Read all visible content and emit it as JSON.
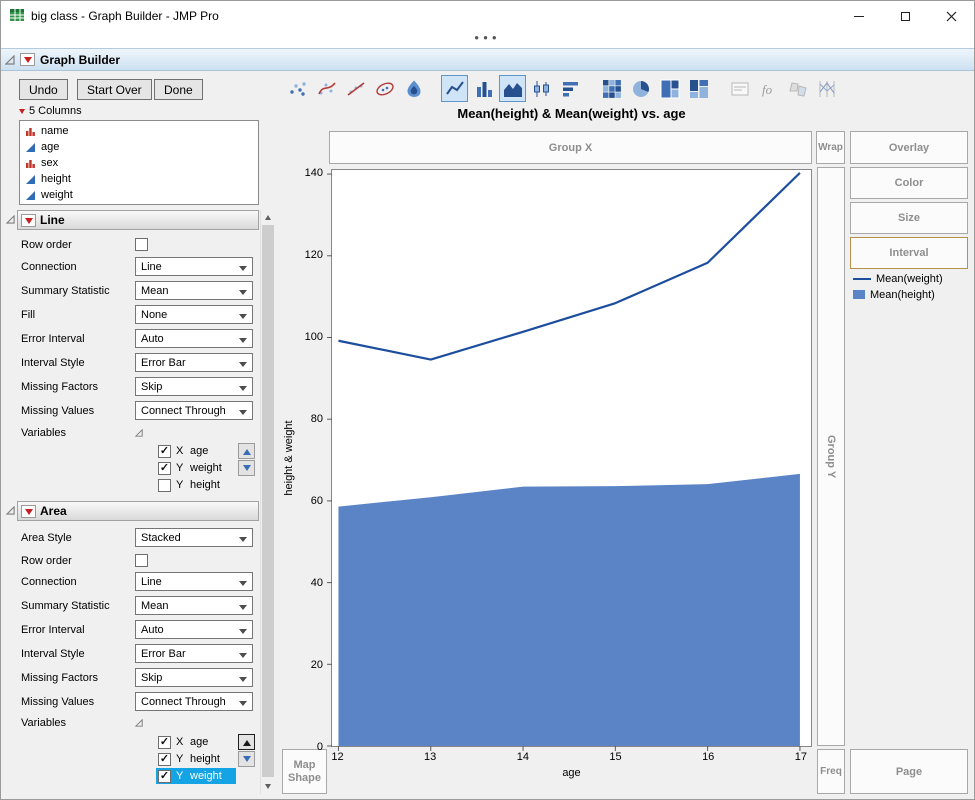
{
  "window": {
    "title": "big class - Graph Builder - JMP Pro",
    "dots": "●●●"
  },
  "gb": {
    "title": "Graph Builder"
  },
  "toolbar": {
    "undo": "Undo",
    "start_over": "Start Over",
    "done": "Done"
  },
  "palette": {
    "icons": [
      "points",
      "smoother",
      "line-of-fit",
      "ellipse",
      "contour",
      "line",
      "bar",
      "area",
      "box-plot",
      "histogram",
      "heatmap",
      "pie",
      "treemap",
      "mosaic",
      "caption-box",
      "formula",
      "map-shapes",
      "parallel-plot"
    ],
    "selected": [
      "line",
      "area"
    ]
  },
  "columns": {
    "header": "5 Columns",
    "items": [
      {
        "name": "name",
        "type": "nominal"
      },
      {
        "name": "age",
        "type": "continuous"
      },
      {
        "name": "sex",
        "type": "nominal"
      },
      {
        "name": "height",
        "type": "continuous"
      },
      {
        "name": "weight",
        "type": "continuous"
      }
    ]
  },
  "line": {
    "title": "Line",
    "row_order_label": "Row order",
    "row_order_checked": false,
    "connection_label": "Connection",
    "connection_value": "Line",
    "summary_label": "Summary Statistic",
    "summary_value": "Mean",
    "fill_label": "Fill",
    "fill_value": "None",
    "error_label": "Error Interval",
    "error_value": "Auto",
    "interval_label": "Interval Style",
    "interval_value": "Error Bar",
    "missing_factors_label": "Missing Factors",
    "missing_factors_value": "Skip",
    "missing_values_label": "Missing Values",
    "missing_values_value": "Connect Through",
    "variables_label": "Variables",
    "vars": [
      {
        "checked": true,
        "role": "X",
        "name": "age"
      },
      {
        "checked": true,
        "role": "Y",
        "name": "weight"
      },
      {
        "checked": false,
        "role": "Y",
        "name": "height"
      }
    ]
  },
  "area": {
    "title": "Area",
    "area_style_label": "Area Style",
    "area_style_value": "Stacked",
    "row_order_label": "Row order",
    "row_order_checked": false,
    "connection_label": "Connection",
    "connection_value": "Line",
    "summary_label": "Summary Statistic",
    "summary_value": "Mean",
    "error_label": "Error Interval",
    "error_value": "Auto",
    "interval_label": "Interval Style",
    "interval_value": "Error Bar",
    "missing_factors_label": "Missing Factors",
    "missing_factors_value": "Skip",
    "missing_values_label": "Missing Values",
    "missing_values_value": "Connect Through",
    "variables_label": "Variables",
    "vars": [
      {
        "checked": true,
        "role": "X",
        "name": "age",
        "selected": false
      },
      {
        "checked": true,
        "role": "Y",
        "name": "height",
        "selected": false
      },
      {
        "checked": true,
        "role": "Y",
        "name": "weight",
        "selected": true
      }
    ]
  },
  "zones": {
    "group_x": "Group X",
    "wrap": "Wrap",
    "overlay": "Overlay",
    "color": "Color",
    "size": "Size",
    "interval": "Interval",
    "group_y": "Group Y",
    "map_shape": "Map Shape",
    "freq": "Freq",
    "page": "Page"
  },
  "chart_data": {
    "type": "line+area",
    "title": "Mean(height) & Mean(weight) vs. age",
    "xlabel": "age",
    "ylabel": "height & weight",
    "x": [
      12,
      13,
      14,
      15,
      16,
      17
    ],
    "series": [
      {
        "name": "Mean(weight)",
        "type": "line",
        "color": "#1d4e9e",
        "values": [
          99.2,
          94.6,
          101.4,
          108.4,
          118.3,
          140.3
        ]
      },
      {
        "name": "Mean(height)",
        "type": "area",
        "color": "#5b84c7",
        "values": [
          58.6,
          60.9,
          63.5,
          63.6,
          64.1,
          66.6
        ]
      }
    ],
    "xticks": [
      12,
      13,
      14,
      15,
      16,
      17
    ],
    "yticks": [
      0,
      20,
      40,
      60,
      80,
      100,
      120,
      140
    ],
    "xlim": [
      11.93,
      17.12
    ],
    "ylim": [
      0,
      141
    ],
    "grid": false,
    "legend_position": "right"
  }
}
